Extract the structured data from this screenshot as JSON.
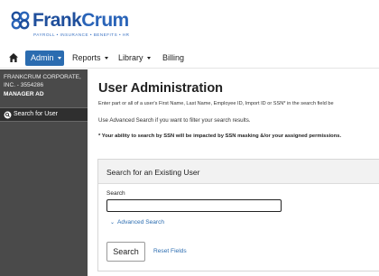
{
  "header": {
    "logo_frank": "Frank",
    "logo_crum": "Crum",
    "logo_tagline": "PAYROLL • INSURANCE • BENEFITS • HR"
  },
  "nav": {
    "home_icon": "home-icon",
    "items": [
      {
        "label": "Admin",
        "has_menu": true,
        "active": true
      },
      {
        "label": "Reports",
        "has_menu": true,
        "active": false
      },
      {
        "label": "Library",
        "has_menu": true,
        "active": false
      },
      {
        "label": "Billing",
        "has_menu": false,
        "active": false
      }
    ]
  },
  "sidebar": {
    "company_line1": "FRANKCRUM CORPORATE,",
    "company_line2": "INC. - 3554286",
    "role": "MANAGER AD",
    "items": [
      {
        "label": "Search for User",
        "icon": "search-icon",
        "selected": true
      }
    ]
  },
  "main": {
    "title": "User Administration",
    "instruction": "Enter part or all of a user's First Name, Last Name, Employee ID, Import ID or SSN* in the search field be",
    "advanced_hint": "Use Advanced Search if you want to filter your search results.",
    "ssn_note": "* Your ability to search by SSN will be impacted by SSN masking &/or your assigned permissions.",
    "panel": {
      "title": "Search for an Existing User",
      "search_label": "Search",
      "search_value": "",
      "advanced_link": "Advanced Search",
      "search_button": "Search",
      "reset_link": "Reset Fields"
    }
  },
  "colors": {
    "brand_blue": "#1f4f9c",
    "nav_active": "#2b6cb0",
    "link_blue": "#2b6cb0",
    "sidebar_bg": "#4a4a4a",
    "sidebar_selected_bg": "#2f2f2f"
  }
}
